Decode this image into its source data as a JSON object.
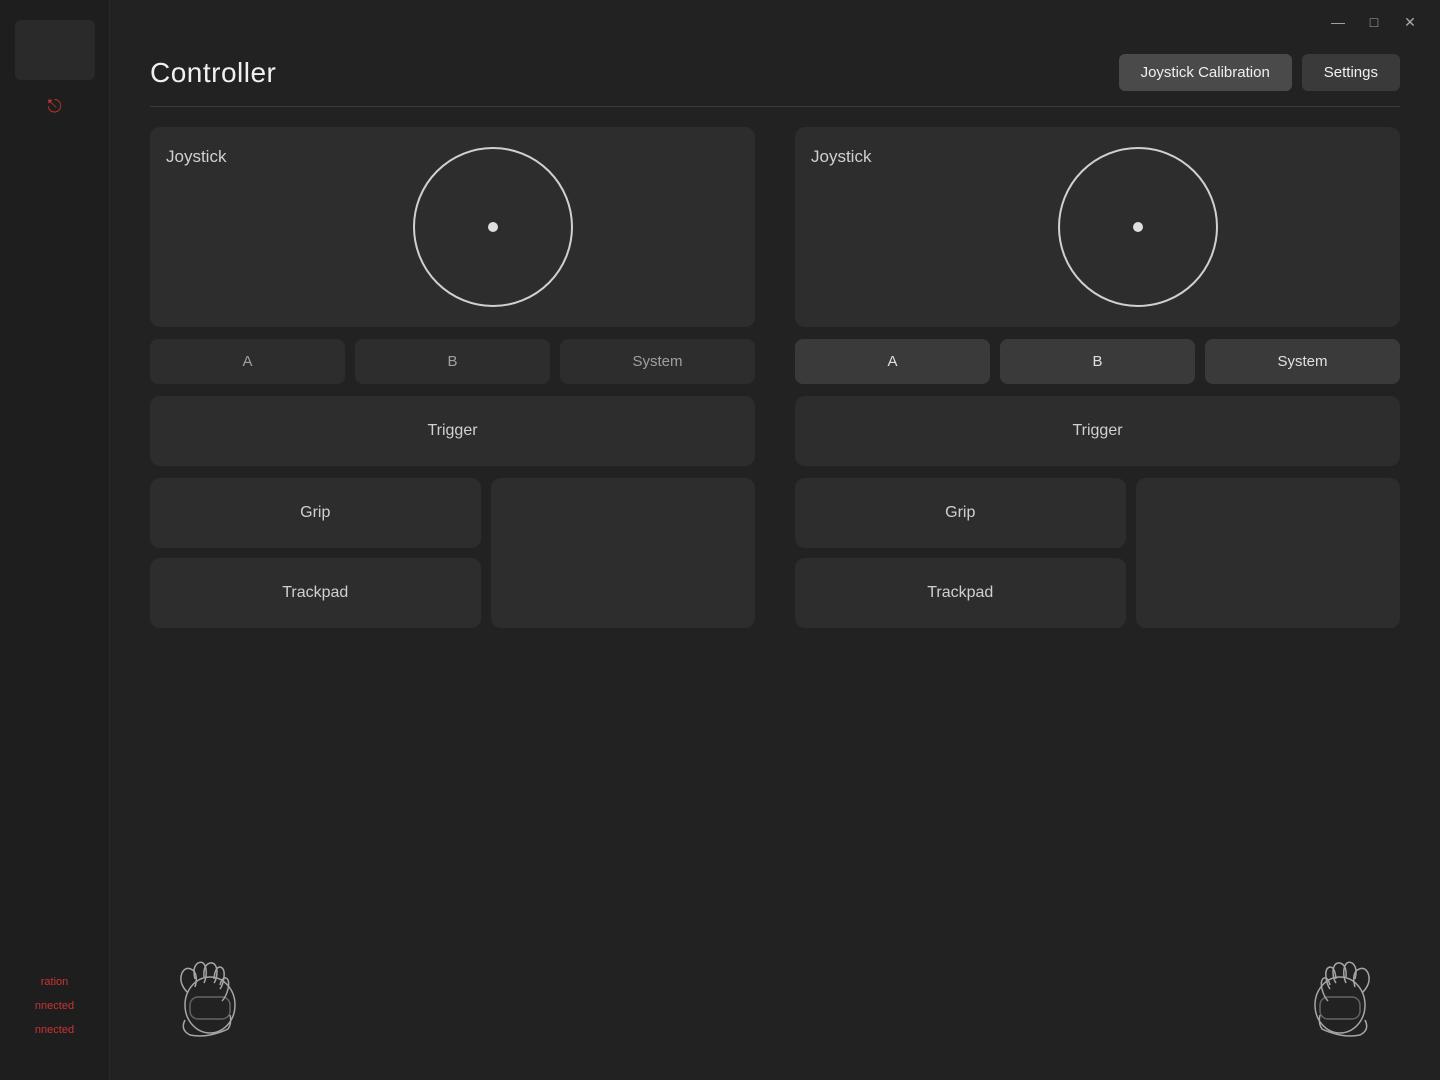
{
  "app": {
    "title": "Controller",
    "titlebar": {
      "minimize": "—",
      "maximize": "□",
      "close": "✕"
    },
    "header_buttons": [
      {
        "label": "Joystick Calibration",
        "id": "joystick-calibration",
        "active": true
      },
      {
        "label": "Settings",
        "id": "settings",
        "active": false
      }
    ]
  },
  "sidebar": {
    "item_block": "",
    "nav_items": [],
    "export_icon": "⎋",
    "status_items": [
      {
        "label": "ration"
      },
      {
        "label": "nnected"
      },
      {
        "label": "nnected"
      }
    ]
  },
  "left_controller": {
    "joystick_label": "Joystick",
    "buttons": [
      {
        "label": "A",
        "active": false
      },
      {
        "label": "B",
        "active": false
      },
      {
        "label": "System",
        "active": false
      }
    ],
    "trigger_label": "Trigger",
    "grip_label": "Grip",
    "trackpad_label": "Trackpad"
  },
  "right_controller": {
    "joystick_label": "Joystick",
    "buttons": [
      {
        "label": "A",
        "active": true
      },
      {
        "label": "B",
        "active": true
      },
      {
        "label": "System",
        "active": true
      }
    ],
    "trigger_label": "Trigger",
    "grip_label": "Grip",
    "trackpad_label": "Trackpad"
  }
}
